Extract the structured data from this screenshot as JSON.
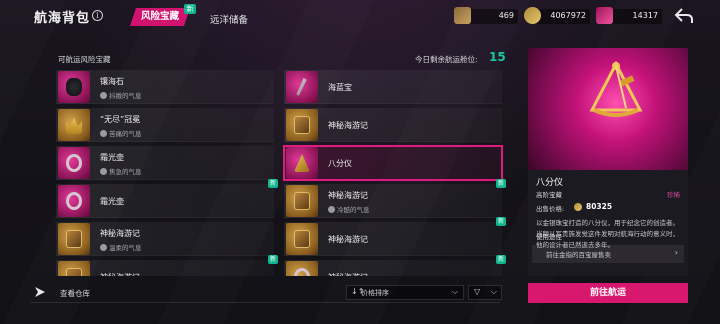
{
  "header": {
    "title": "航海背包",
    "info_icon": "i",
    "tabs": [
      {
        "label": "风险宝藏",
        "active": true,
        "badge": "新"
      },
      {
        "label": "远洋储备",
        "active": false
      }
    ],
    "currencies": [
      {
        "icon": "map-currency-icon",
        "value": "469"
      },
      {
        "icon": "coin-currency-icon",
        "value": "4067972"
      },
      {
        "icon": "gem-currency-icon",
        "value": "14317"
      }
    ]
  },
  "list": {
    "header": "可航运风险宝藏",
    "remaining_label": "今日剩余航运舱位:",
    "remaining_value": "15",
    "items": [
      {
        "name": "镶海石",
        "tag": "抖擞的气息",
        "rarity": "pink",
        "art": "rock",
        "new": false
      },
      {
        "name": "海蓝宝",
        "tag": "",
        "rarity": "pink",
        "art": "spyglass",
        "new": false
      },
      {
        "name": "“无尽”冠冕",
        "tag": "苦痛的气息",
        "rarity": "gold",
        "art": "crown",
        "new": false
      },
      {
        "name": "神秘海游记",
        "tag": "",
        "rarity": "gold",
        "art": "book",
        "new": false
      },
      {
        "name": "霜光壶",
        "tag": "焦急的气息",
        "rarity": "pink",
        "art": "rope",
        "new": false
      },
      {
        "name": "八分仪",
        "tag": "",
        "rarity": "pink",
        "art": "sextant",
        "new": false,
        "selected": true
      },
      {
        "name": "霜光壶",
        "tag": "",
        "rarity": "pink",
        "art": "rope",
        "new": true
      },
      {
        "name": "神秘海游记",
        "tag": "冷酷的气息",
        "rarity": "gold",
        "art": "book",
        "new": true
      },
      {
        "name": "神秘海游记",
        "tag": "温柔的气息",
        "rarity": "gold",
        "art": "book",
        "new": false
      },
      {
        "name": "神秘海游记",
        "tag": "",
        "rarity": "gold",
        "art": "book",
        "new": true
      },
      {
        "name": "神秘海游记",
        "tag": "",
        "rarity": "gold",
        "art": "book",
        "new": true
      },
      {
        "name": "神秘海游记",
        "tag": "",
        "rarity": "gold",
        "art": "rope",
        "new": true
      }
    ]
  },
  "bottom": {
    "view_warehouse": "查看仓库",
    "sort_label": "价格排序",
    "sort_icon": "↓↑",
    "filter_icon": "▽"
  },
  "detail": {
    "name": "八分仪",
    "rarity": "高阶宝藏",
    "owned": "珍稀",
    "price_label": "出售价格:",
    "price_value": "80325",
    "description": "以金银珠宝打造的八分仪，用于纪念它的创造者。当颜从军贵族发觉这件发明对航海行动的意义时，他的设计者已然逝去多年。",
    "usage_title": "使用途径",
    "usage_item": "前往金指的百宝屋售卖",
    "go_button": "前往航运"
  },
  "colors": {
    "accent": "#d8176f",
    "new_badge": "#13b58f",
    "remaining": "#1bc6a2"
  }
}
